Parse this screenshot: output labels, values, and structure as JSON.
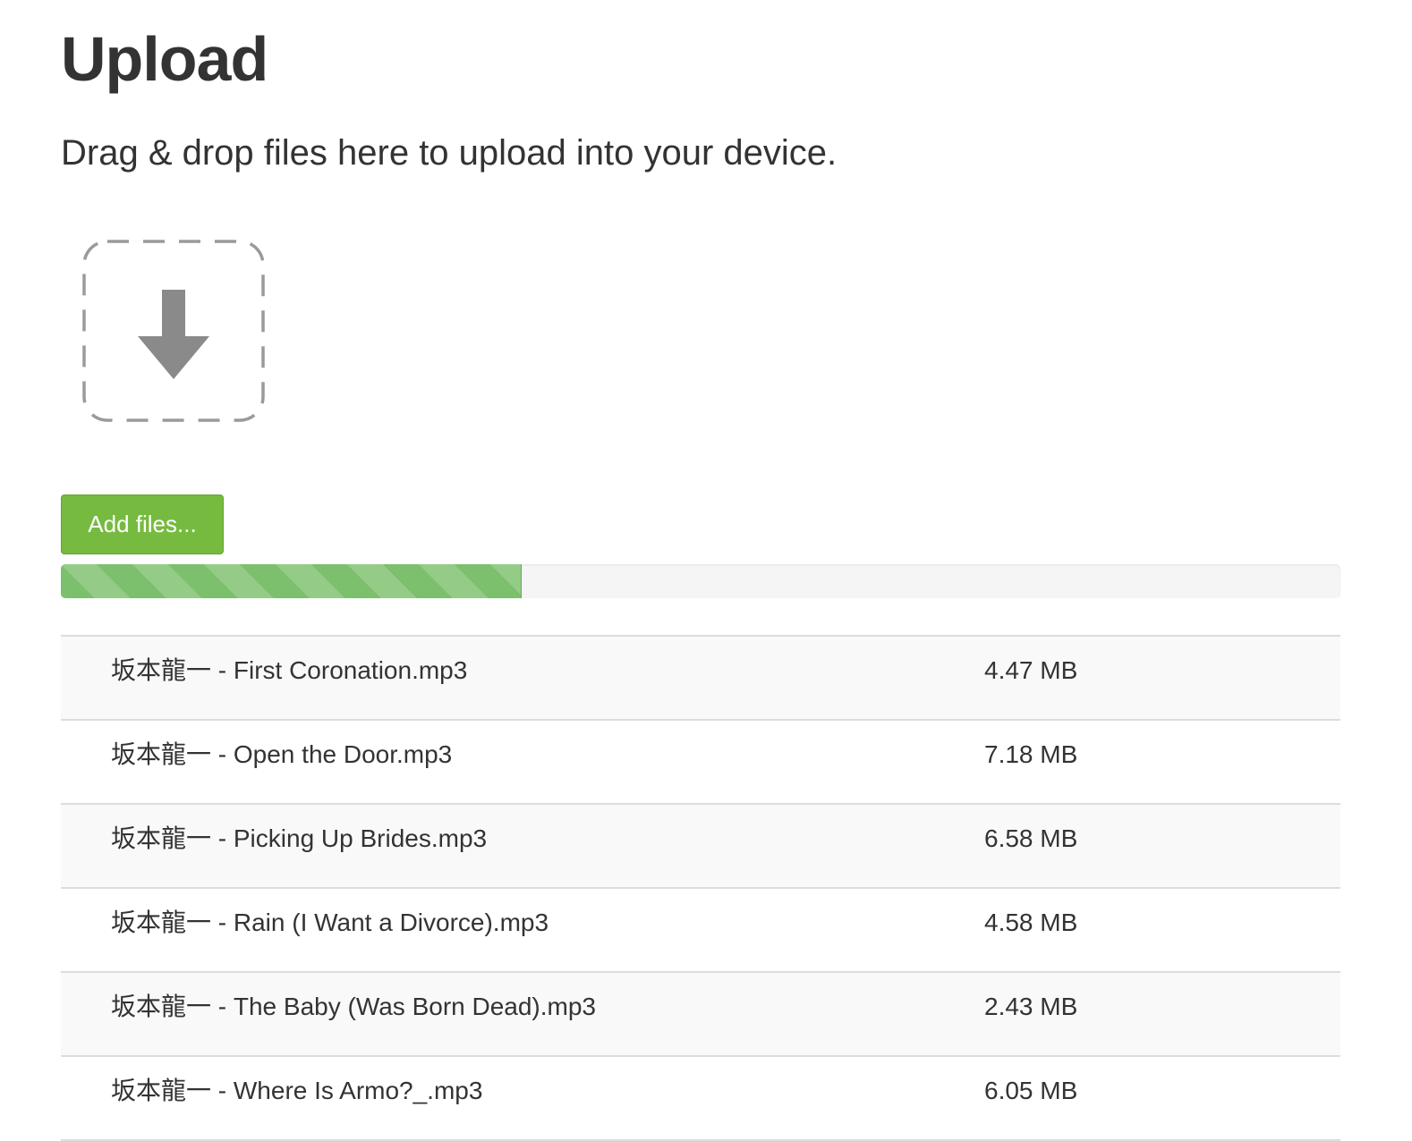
{
  "header": {
    "title": "Upload",
    "subtitle": "Drag & drop files here to upload into your device."
  },
  "dropzone": {
    "icon": "download-arrow-icon"
  },
  "toolbar": {
    "add_files_label": "Add files...",
    "add_files_color": "#76bb3f"
  },
  "progress": {
    "percent": 36,
    "bar_color": "#7cbf6c"
  },
  "files": [
    {
      "name": "坂本龍一 - First Coronation.mp3",
      "size": "4.47 MB"
    },
    {
      "name": "坂本龍一 - Open the Door.mp3",
      "size": "7.18 MB"
    },
    {
      "name": "坂本龍一 - Picking Up Brides.mp3",
      "size": "6.58 MB"
    },
    {
      "name": "坂本龍一 - Rain (I Want a Divorce).mp3",
      "size": "4.58 MB"
    },
    {
      "name": "坂本龍一 - The Baby (Was Born Dead).mp3",
      "size": "2.43 MB"
    },
    {
      "name": "坂本龍一 - Where Is Armo?_.mp3",
      "size": "6.05 MB"
    }
  ]
}
